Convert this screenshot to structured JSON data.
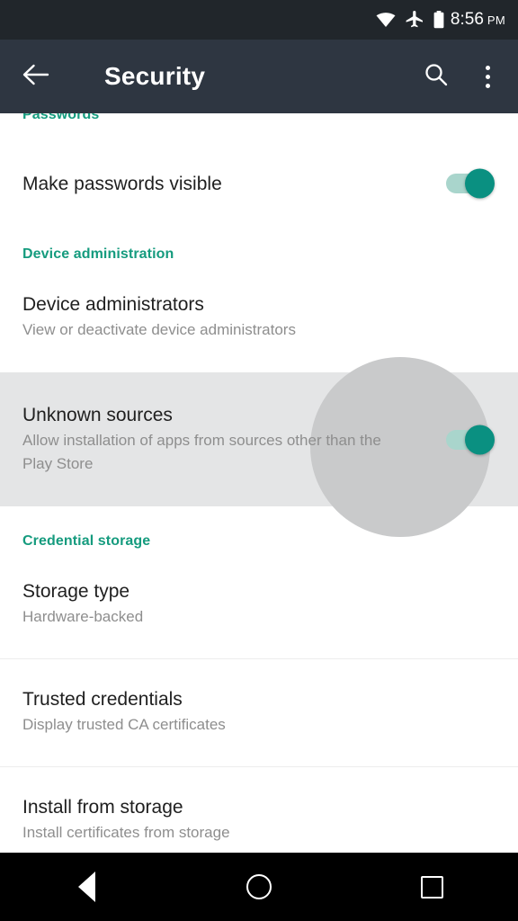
{
  "status_bar": {
    "icons": [
      "wifi-icon",
      "airplane-mode-icon",
      "battery-icon"
    ],
    "time": "8:56",
    "meridiem": "PM"
  },
  "app_bar": {
    "back_icon": "back-arrow-icon",
    "title": "Security",
    "search_icon": "search-icon",
    "overflow_icon": "overflow-menu-icon"
  },
  "colors": {
    "accent": "#159b7e",
    "toggle_on": "#0a9081",
    "toggle_track": "#a9d5cc",
    "app_bar": "#2e3641",
    "status_bar": "#21262b",
    "highlight_row": "#e4e5e6",
    "ripple": "#c9cacb"
  },
  "sections": [
    {
      "header": "Passwords",
      "clipped": true,
      "items": [
        {
          "title": "Make passwords visible",
          "subtitle": "",
          "control": "switch",
          "checked": true
        }
      ]
    },
    {
      "header": "Device administration",
      "clipped": false,
      "items": [
        {
          "title": "Device administrators",
          "subtitle": "View or deactivate device administrators",
          "control": "none",
          "checked": false
        },
        {
          "title": "Unknown sources",
          "subtitle": "Allow installation of apps from sources other than the Play Store",
          "control": "switch",
          "checked": true,
          "pressed": true
        }
      ]
    },
    {
      "header": "Credential storage",
      "clipped": false,
      "items": [
        {
          "title": "Storage type",
          "subtitle": "Hardware-backed",
          "control": "none",
          "checked": false
        },
        {
          "title": "Trusted credentials",
          "subtitle": "Display trusted CA certificates",
          "control": "none",
          "checked": false
        },
        {
          "title": "Install from storage",
          "subtitle": "Install certificates from storage",
          "control": "none",
          "checked": false
        }
      ]
    }
  ],
  "nav_bar": {
    "back": "back-triangle-icon",
    "home": "home-circle-icon",
    "recents": "recents-square-icon"
  }
}
